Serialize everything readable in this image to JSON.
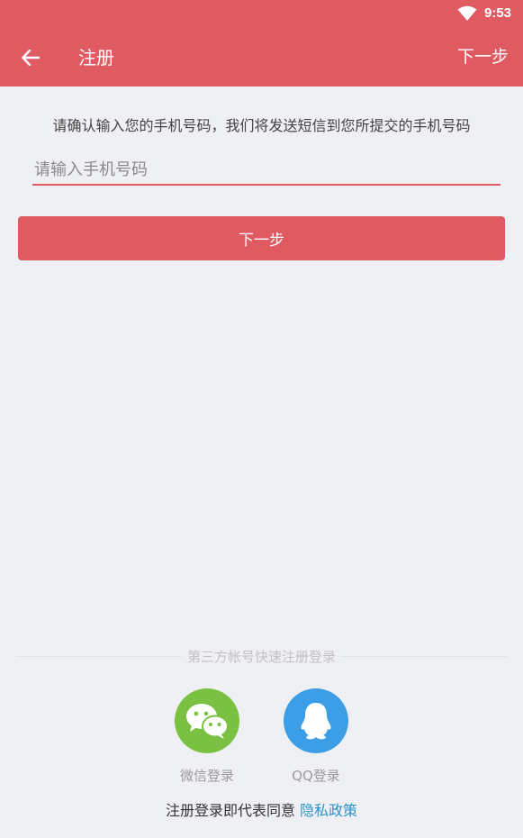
{
  "status_bar": {
    "time": "9:53",
    "wifi_icon": "wifi-icon"
  },
  "app_bar": {
    "back_icon": "back-arrow-icon",
    "title": "注册",
    "next_label": "下一步"
  },
  "form": {
    "hint": "请确认输入您的手机号码，我们将发送短信到您所提交的手机号码",
    "phone_placeholder": "请输入手机号码",
    "phone_value": "",
    "submit_label": "下一步"
  },
  "third_party": {
    "divider_label": "第三方帐号快速注册登录",
    "wechat": {
      "label": "微信登录",
      "icon": "wechat-icon",
      "color": "#7ac143"
    },
    "qq": {
      "label": "QQ登录",
      "icon": "qq-icon",
      "color": "#3d9ee8"
    }
  },
  "agreement": {
    "text": "注册登录即代表同意",
    "link": "隐私政策"
  },
  "colors": {
    "brand": "#e05a62",
    "background": "#eff0f4",
    "link": "#2c93c8"
  }
}
